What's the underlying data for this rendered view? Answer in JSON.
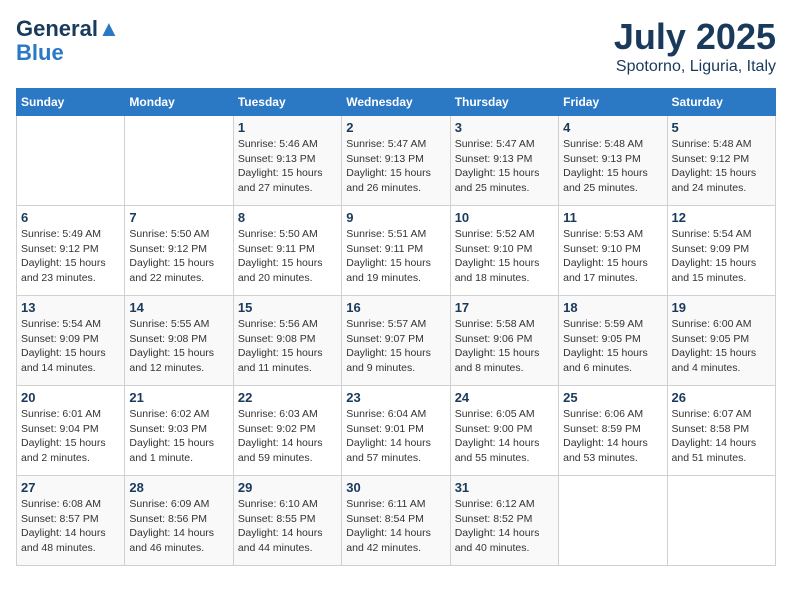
{
  "header": {
    "logo_line1": "General",
    "logo_line2": "Blue",
    "month": "July 2025",
    "location": "Spotorno, Liguria, Italy"
  },
  "weekdays": [
    "Sunday",
    "Monday",
    "Tuesday",
    "Wednesday",
    "Thursday",
    "Friday",
    "Saturday"
  ],
  "weeks": [
    [
      {
        "day": null
      },
      {
        "day": null
      },
      {
        "day": "1",
        "sunrise": "5:46 AM",
        "sunset": "9:13 PM",
        "daylight": "15 hours and 27 minutes."
      },
      {
        "day": "2",
        "sunrise": "5:47 AM",
        "sunset": "9:13 PM",
        "daylight": "15 hours and 26 minutes."
      },
      {
        "day": "3",
        "sunrise": "5:47 AM",
        "sunset": "9:13 PM",
        "daylight": "15 hours and 25 minutes."
      },
      {
        "day": "4",
        "sunrise": "5:48 AM",
        "sunset": "9:13 PM",
        "daylight": "15 hours and 25 minutes."
      },
      {
        "day": "5",
        "sunrise": "5:48 AM",
        "sunset": "9:12 PM",
        "daylight": "15 hours and 24 minutes."
      }
    ],
    [
      {
        "day": "6",
        "sunrise": "5:49 AM",
        "sunset": "9:12 PM",
        "daylight": "15 hours and 23 minutes."
      },
      {
        "day": "7",
        "sunrise": "5:50 AM",
        "sunset": "9:12 PM",
        "daylight": "15 hours and 22 minutes."
      },
      {
        "day": "8",
        "sunrise": "5:50 AM",
        "sunset": "9:11 PM",
        "daylight": "15 hours and 20 minutes."
      },
      {
        "day": "9",
        "sunrise": "5:51 AM",
        "sunset": "9:11 PM",
        "daylight": "15 hours and 19 minutes."
      },
      {
        "day": "10",
        "sunrise": "5:52 AM",
        "sunset": "9:10 PM",
        "daylight": "15 hours and 18 minutes."
      },
      {
        "day": "11",
        "sunrise": "5:53 AM",
        "sunset": "9:10 PM",
        "daylight": "15 hours and 17 minutes."
      },
      {
        "day": "12",
        "sunrise": "5:54 AM",
        "sunset": "9:09 PM",
        "daylight": "15 hours and 15 minutes."
      }
    ],
    [
      {
        "day": "13",
        "sunrise": "5:54 AM",
        "sunset": "9:09 PM",
        "daylight": "15 hours and 14 minutes."
      },
      {
        "day": "14",
        "sunrise": "5:55 AM",
        "sunset": "9:08 PM",
        "daylight": "15 hours and 12 minutes."
      },
      {
        "day": "15",
        "sunrise": "5:56 AM",
        "sunset": "9:08 PM",
        "daylight": "15 hours and 11 minutes."
      },
      {
        "day": "16",
        "sunrise": "5:57 AM",
        "sunset": "9:07 PM",
        "daylight": "15 hours and 9 minutes."
      },
      {
        "day": "17",
        "sunrise": "5:58 AM",
        "sunset": "9:06 PM",
        "daylight": "15 hours and 8 minutes."
      },
      {
        "day": "18",
        "sunrise": "5:59 AM",
        "sunset": "9:05 PM",
        "daylight": "15 hours and 6 minutes."
      },
      {
        "day": "19",
        "sunrise": "6:00 AM",
        "sunset": "9:05 PM",
        "daylight": "15 hours and 4 minutes."
      }
    ],
    [
      {
        "day": "20",
        "sunrise": "6:01 AM",
        "sunset": "9:04 PM",
        "daylight": "15 hours and 2 minutes."
      },
      {
        "day": "21",
        "sunrise": "6:02 AM",
        "sunset": "9:03 PM",
        "daylight": "15 hours and 1 minute."
      },
      {
        "day": "22",
        "sunrise": "6:03 AM",
        "sunset": "9:02 PM",
        "daylight": "14 hours and 59 minutes."
      },
      {
        "day": "23",
        "sunrise": "6:04 AM",
        "sunset": "9:01 PM",
        "daylight": "14 hours and 57 minutes."
      },
      {
        "day": "24",
        "sunrise": "6:05 AM",
        "sunset": "9:00 PM",
        "daylight": "14 hours and 55 minutes."
      },
      {
        "day": "25",
        "sunrise": "6:06 AM",
        "sunset": "8:59 PM",
        "daylight": "14 hours and 53 minutes."
      },
      {
        "day": "26",
        "sunrise": "6:07 AM",
        "sunset": "8:58 PM",
        "daylight": "14 hours and 51 minutes."
      }
    ],
    [
      {
        "day": "27",
        "sunrise": "6:08 AM",
        "sunset": "8:57 PM",
        "daylight": "14 hours and 48 minutes."
      },
      {
        "day": "28",
        "sunrise": "6:09 AM",
        "sunset": "8:56 PM",
        "daylight": "14 hours and 46 minutes."
      },
      {
        "day": "29",
        "sunrise": "6:10 AM",
        "sunset": "8:55 PM",
        "daylight": "14 hours and 44 minutes."
      },
      {
        "day": "30",
        "sunrise": "6:11 AM",
        "sunset": "8:54 PM",
        "daylight": "14 hours and 42 minutes."
      },
      {
        "day": "31",
        "sunrise": "6:12 AM",
        "sunset": "8:52 PM",
        "daylight": "14 hours and 40 minutes."
      },
      {
        "day": null
      },
      {
        "day": null
      }
    ]
  ]
}
